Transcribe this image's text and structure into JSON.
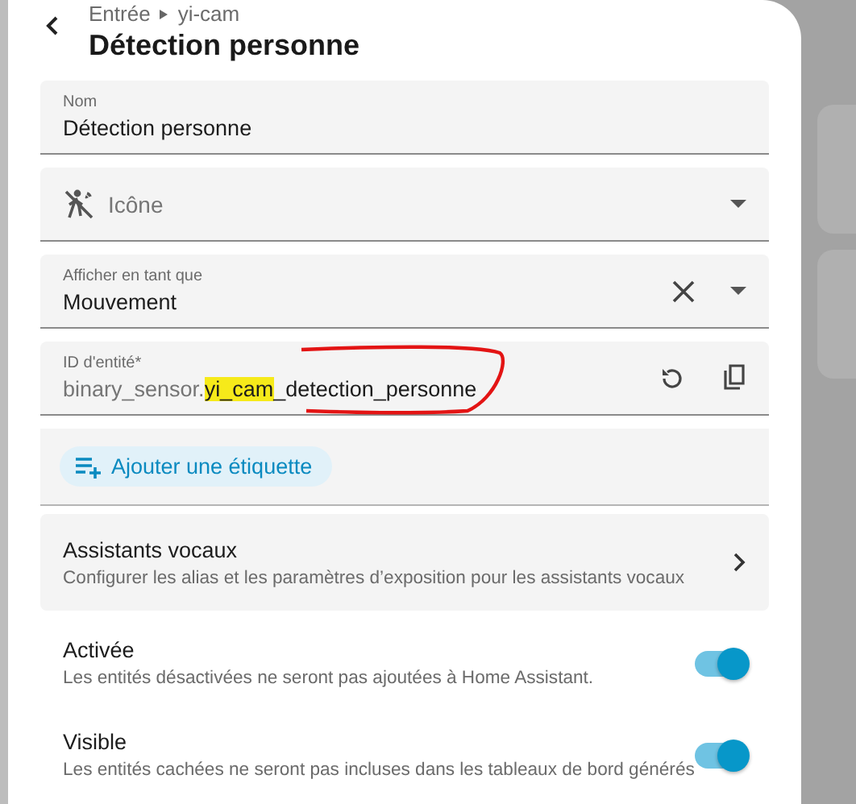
{
  "header": {
    "breadcrumb": [
      "Entrée",
      "yi-cam"
    ],
    "title": "Détection personne"
  },
  "fields": [
    {
      "kind": "text",
      "label": "Nom",
      "value": "Détection personne"
    },
    {
      "kind": "icon",
      "placeholder": "Icône"
    },
    {
      "kind": "select",
      "label": "Afficher en tant que",
      "value": "Mouvement"
    },
    {
      "kind": "entity",
      "label": "ID d'entité*",
      "parts": [
        {
          "kind": "prefix",
          "text": "binary_sensor."
        },
        {
          "kind": "highlight",
          "text": "yi_cam"
        },
        {
          "kind": "plain",
          "text": "_detection_personne"
        }
      ],
      "annotation": {
        "color": "#e31414"
      }
    }
  ],
  "label_button": "Ajouter une étiquette",
  "voice": {
    "title": "Assistants vocaux",
    "description": "Configurer les alias et les paramètres d’exposition pour les assistants vocaux"
  },
  "toggles": [
    {
      "title": "Activée",
      "description": "Les entités désactivées ne seront pas ajoutées à Home Assistant.",
      "on": true
    },
    {
      "title": "Visible",
      "description": "Les entités cachées ne seront pas incluses dans les tableaux de bord générés",
      "on": true
    }
  ]
}
